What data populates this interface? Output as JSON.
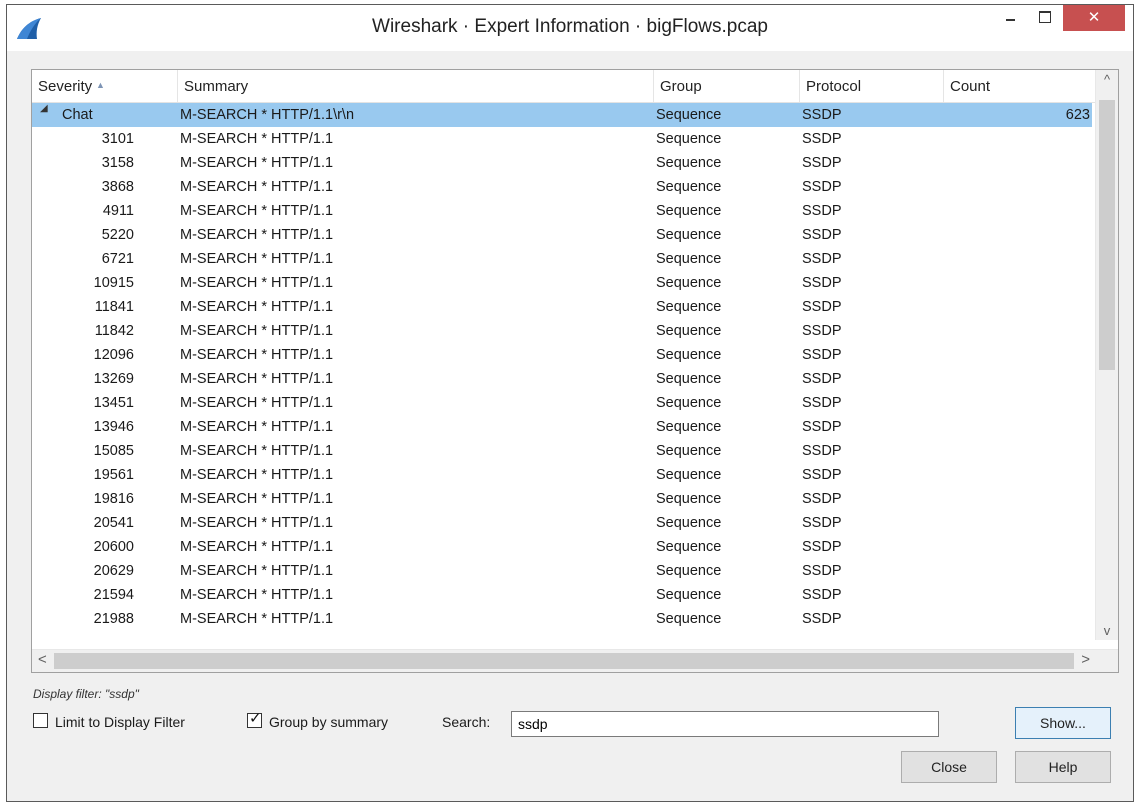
{
  "window": {
    "title": "Wireshark · Expert Information · bigFlows.pcap",
    "close_symbol": "✕"
  },
  "columns": {
    "severity": "Severity",
    "summary": "Summary",
    "group": "Group",
    "protocol": "Protocol",
    "count": "Count"
  },
  "parent_row": {
    "severity": "Chat",
    "summary": "M-SEARCH * HTTP/1.1\\r\\n",
    "group": "Sequence",
    "protocol": "SSDP",
    "count": "623",
    "expander_icon": "triangle-down-icon"
  },
  "child_rows": [
    {
      "severity": "3101",
      "summary": "M-SEARCH * HTTP/1.1",
      "group": "Sequence",
      "protocol": "SSDP"
    },
    {
      "severity": "3158",
      "summary": "M-SEARCH * HTTP/1.1",
      "group": "Sequence",
      "protocol": "SSDP"
    },
    {
      "severity": "3868",
      "summary": "M-SEARCH * HTTP/1.1",
      "group": "Sequence",
      "protocol": "SSDP"
    },
    {
      "severity": "4911",
      "summary": "M-SEARCH * HTTP/1.1",
      "group": "Sequence",
      "protocol": "SSDP"
    },
    {
      "severity": "5220",
      "summary": "M-SEARCH * HTTP/1.1",
      "group": "Sequence",
      "protocol": "SSDP"
    },
    {
      "severity": "6721",
      "summary": "M-SEARCH * HTTP/1.1",
      "group": "Sequence",
      "protocol": "SSDP"
    },
    {
      "severity": "10915",
      "summary": "M-SEARCH * HTTP/1.1",
      "group": "Sequence",
      "protocol": "SSDP"
    },
    {
      "severity": "11841",
      "summary": "M-SEARCH * HTTP/1.1",
      "group": "Sequence",
      "protocol": "SSDP"
    },
    {
      "severity": "11842",
      "summary": "M-SEARCH * HTTP/1.1",
      "group": "Sequence",
      "protocol": "SSDP"
    },
    {
      "severity": "12096",
      "summary": "M-SEARCH * HTTP/1.1",
      "group": "Sequence",
      "protocol": "SSDP"
    },
    {
      "severity": "13269",
      "summary": "M-SEARCH * HTTP/1.1",
      "group": "Sequence",
      "protocol": "SSDP"
    },
    {
      "severity": "13451",
      "summary": "M-SEARCH * HTTP/1.1",
      "group": "Sequence",
      "protocol": "SSDP"
    },
    {
      "severity": "13946",
      "summary": "M-SEARCH * HTTP/1.1",
      "group": "Sequence",
      "protocol": "SSDP"
    },
    {
      "severity": "15085",
      "summary": "M-SEARCH * HTTP/1.1",
      "group": "Sequence",
      "protocol": "SSDP"
    },
    {
      "severity": "19561",
      "summary": "M-SEARCH * HTTP/1.1",
      "group": "Sequence",
      "protocol": "SSDP"
    },
    {
      "severity": "19816",
      "summary": "M-SEARCH * HTTP/1.1",
      "group": "Sequence",
      "protocol": "SSDP"
    },
    {
      "severity": "20541",
      "summary": "M-SEARCH * HTTP/1.1",
      "group": "Sequence",
      "protocol": "SSDP"
    },
    {
      "severity": "20600",
      "summary": "M-SEARCH * HTTP/1.1",
      "group": "Sequence",
      "protocol": "SSDP"
    },
    {
      "severity": "20629",
      "summary": "M-SEARCH * HTTP/1.1",
      "group": "Sequence",
      "protocol": "SSDP"
    },
    {
      "severity": "21594",
      "summary": "M-SEARCH * HTTP/1.1",
      "group": "Sequence",
      "protocol": "SSDP"
    },
    {
      "severity": "21988",
      "summary": "M-SEARCH * HTTP/1.1",
      "group": "Sequence",
      "protocol": "SSDP"
    }
  ],
  "scrollbars": {
    "up_arrow": "^",
    "down_arrow": "v",
    "left_arrow": "<",
    "right_arrow": ">"
  },
  "filter_note": "Display filter: \"ssdp\"",
  "options": {
    "limit_label": "Limit to Display Filter",
    "limit_checked": false,
    "group_label": "Group by summary",
    "group_checked": true,
    "check_mark": "✓"
  },
  "search": {
    "label": "Search:",
    "value": "ssdp"
  },
  "buttons": {
    "show": "Show...",
    "close": "Close",
    "help": "Help"
  },
  "colors": {
    "selection": "#99c9ef",
    "close_button": "#c75050",
    "wireshark_fin": "#1f5fa8"
  }
}
